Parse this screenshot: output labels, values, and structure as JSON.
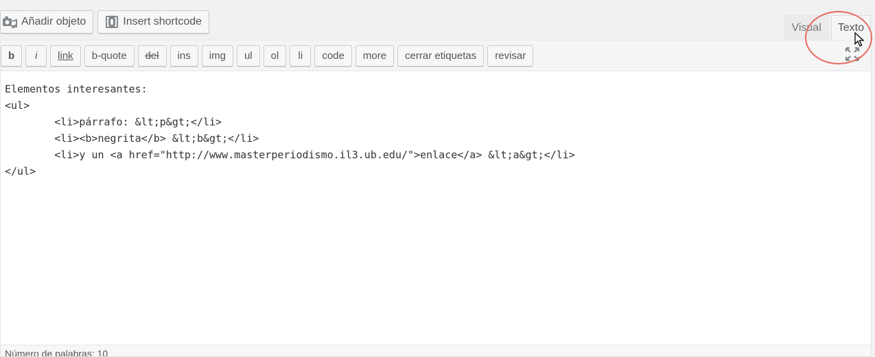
{
  "media_buttons": {
    "add_media": "Añadir objeto",
    "insert_shortcode": "Insert shortcode"
  },
  "tabs": {
    "visual": "Visual",
    "texto": "Texto",
    "active": "Texto"
  },
  "quicktags": [
    {
      "label": "b",
      "style": "bold"
    },
    {
      "label": "i",
      "style": "italic"
    },
    {
      "label": "link",
      "style": "link"
    },
    {
      "label": "b-quote",
      "style": "plain"
    },
    {
      "label": "del",
      "style": "del"
    },
    {
      "label": "ins",
      "style": "plain"
    },
    {
      "label": "img",
      "style": "plain"
    },
    {
      "label": "ul",
      "style": "plain"
    },
    {
      "label": "ol",
      "style": "plain"
    },
    {
      "label": "li",
      "style": "plain"
    },
    {
      "label": "code",
      "style": "plain"
    },
    {
      "label": "more",
      "style": "plain"
    },
    {
      "label": "cerrar etiquetas",
      "style": "plain"
    },
    {
      "label": "revisar",
      "style": "plain"
    }
  ],
  "editor": {
    "content": "Elementos interesantes:\n<ul>\n\t<li>párrafo: &lt;p&gt;</li>\n\t<li><b>negrita</b> &lt;b&gt;</li>\n\t<li>y un <a href=\"http://www.masterperiodismo.il3.ub.edu/\">enlace</a> &lt;a&gt;</li>\n</ul>"
  },
  "status": {
    "word_count": "Número de palabras: 10"
  },
  "colors": {
    "highlight": "#e86a5e"
  }
}
